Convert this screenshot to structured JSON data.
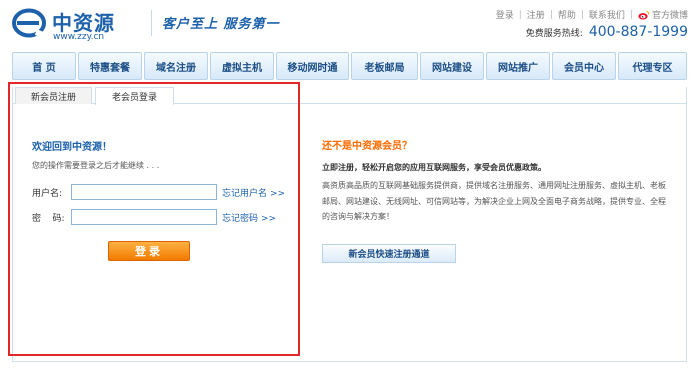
{
  "header": {
    "logo_name": "中资源",
    "logo_url": "www.zzy.cn",
    "slogan": "客户至上  服务第一",
    "toplinks": {
      "login": "登录",
      "register": "注册",
      "help": "帮助",
      "contact": "联系我们",
      "weibo": "官方微博"
    },
    "hotline_label": "免费服务热线:",
    "hotline_number": "400-887-1999"
  },
  "nav": {
    "items": [
      {
        "label": "首 页"
      },
      {
        "label": "特惠套餐"
      },
      {
        "label": "域名注册"
      },
      {
        "label": "虚拟主机"
      },
      {
        "label": "移动网时通"
      },
      {
        "label": "老板邮局"
      },
      {
        "label": "网站建设"
      },
      {
        "label": "网站推广"
      },
      {
        "label": "会员中心"
      },
      {
        "label": "代理专区"
      }
    ]
  },
  "tabs": {
    "register": "新会员注册",
    "login": "老会员登录"
  },
  "login": {
    "title": "欢迎回到中资源！",
    "tip": "您的操作需要登录之后才能继续 . . .",
    "username_label": "用户名:",
    "username_value": "",
    "password_label": "密    码:",
    "password_value": "",
    "forgot_username": "忘记用户名",
    "forgot_password": "忘记密码",
    "arrow": ">>",
    "button": "登录"
  },
  "info": {
    "title": "还不是中资源会员？",
    "lead": "立即注册，轻松开启您的应用互联网服务，享受会员优惠政策。",
    "body": "高资质高品质的互联网基础服务提供商，提供域名注册服务、通用网址注册服务、虚拟主机、老板邮局、网站建设、无线网址、可信网站等，为解决企业上网及全面电子商务战略，提供专业、全程的咨询与解决方案！",
    "fast_register": "新会员快速注册通道"
  },
  "colors": {
    "brand_blue": "#1c61aa",
    "highlight_orange": "#ff6a00",
    "button_orange": "#f07a00",
    "annotation_red": "#e2262a"
  },
  "icons": {
    "logo": "zzy-logo-e-icon",
    "weibo": "weibo-icon"
  }
}
